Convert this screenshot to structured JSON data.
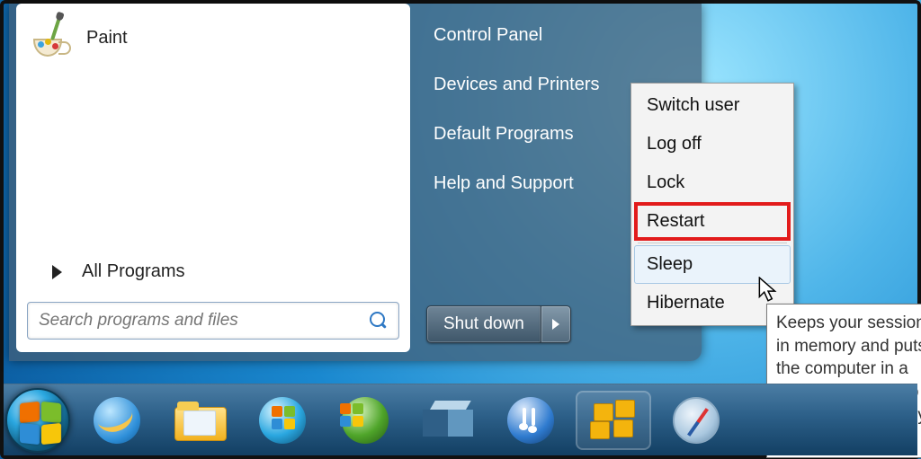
{
  "start_menu": {
    "programs": [
      {
        "label": "Paint",
        "icon": "paint-icon"
      }
    ],
    "all_programs_label": "All Programs",
    "search_placeholder": "Search programs and files"
  },
  "right_pane": {
    "items": [
      "Control Panel",
      "Devices and Printers",
      "Default Programs",
      "Help and Support"
    ]
  },
  "shutdown": {
    "label": "Shut down"
  },
  "power_menu": {
    "items": [
      {
        "label": "Switch user"
      },
      {
        "label": "Log off"
      },
      {
        "label": "Lock"
      },
      {
        "label": "Restart",
        "highlighted": true
      },
      {
        "label": "Sleep",
        "hovered": true
      },
      {
        "label": "Hibernate"
      }
    ]
  },
  "tooltip": {
    "text": "Keeps your session in memory and puts the computer in a low-power state so that you can quickly resume working."
  },
  "taskbar": {
    "items": [
      "start-orb",
      "internet-explorer",
      "file-explorer",
      "windows-media",
      "orb-green",
      "virtualbox",
      "itunes",
      "app-yellow",
      "safari"
    ]
  }
}
